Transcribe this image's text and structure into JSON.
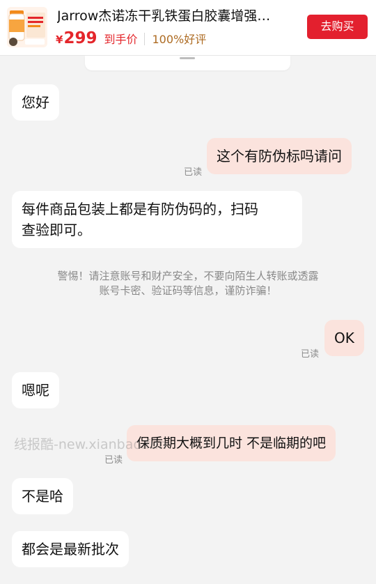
{
  "product": {
    "title": "Jarrow杰诺冻干乳铁蛋白胶囊增强…",
    "currency": "¥",
    "price": "299",
    "price_tag": "到手价",
    "rating": "100%好评",
    "buy_label": "去购买",
    "thumb_brand": "Jarrow",
    "accent_color": "#e3202e"
  },
  "messages": [
    {
      "side": "left",
      "text": "您好"
    },
    {
      "side": "right",
      "text": "这个有防伪标吗请问",
      "status": "已读"
    },
    {
      "side": "left",
      "text_line1": "每件商品包装上都是有防伪码的，扫码",
      "text_line2": "查验即可。"
    },
    {
      "side": "right",
      "text": "OK",
      "status": "已读"
    },
    {
      "side": "left",
      "text": "嗯呢"
    },
    {
      "side": "right",
      "text": "保质期大概到几时 不是临期的吧",
      "status": "已读"
    },
    {
      "side": "left",
      "text": "不是哈"
    },
    {
      "side": "left",
      "text": "都会是最新批次"
    }
  ],
  "notice": {
    "line1": "警惕！请注意账号和财产安全，不要向陌生人转账或透露",
    "line2": "账号卡密、验证码等信息，谨防诈骗！"
  },
  "watermark": "线报酷-new.xianbao.fun"
}
